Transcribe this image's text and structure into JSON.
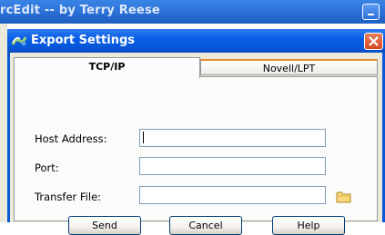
{
  "background_window": {
    "title": "rcEdit -- by Terry Reese"
  },
  "dialog": {
    "title": "Export Settings",
    "tabs": [
      {
        "label": "TCP/IP",
        "selected": true
      },
      {
        "label": "Novell/LPT",
        "selected": false
      }
    ],
    "fields": {
      "host_address": {
        "label": "Host Address:",
        "value": ""
      },
      "port": {
        "label": "Port:",
        "value": ""
      },
      "transfer_file": {
        "label": "Transfer File:",
        "value": ""
      }
    },
    "buttons": {
      "send": "Send",
      "cancel": "Cancel",
      "help": "Help"
    }
  },
  "colors": {
    "titlebar_blue": "#0a5ee6",
    "close_red": "#d5471f",
    "dialog_face": "#ece9d8",
    "tab_highlight": "#e68b2c"
  }
}
